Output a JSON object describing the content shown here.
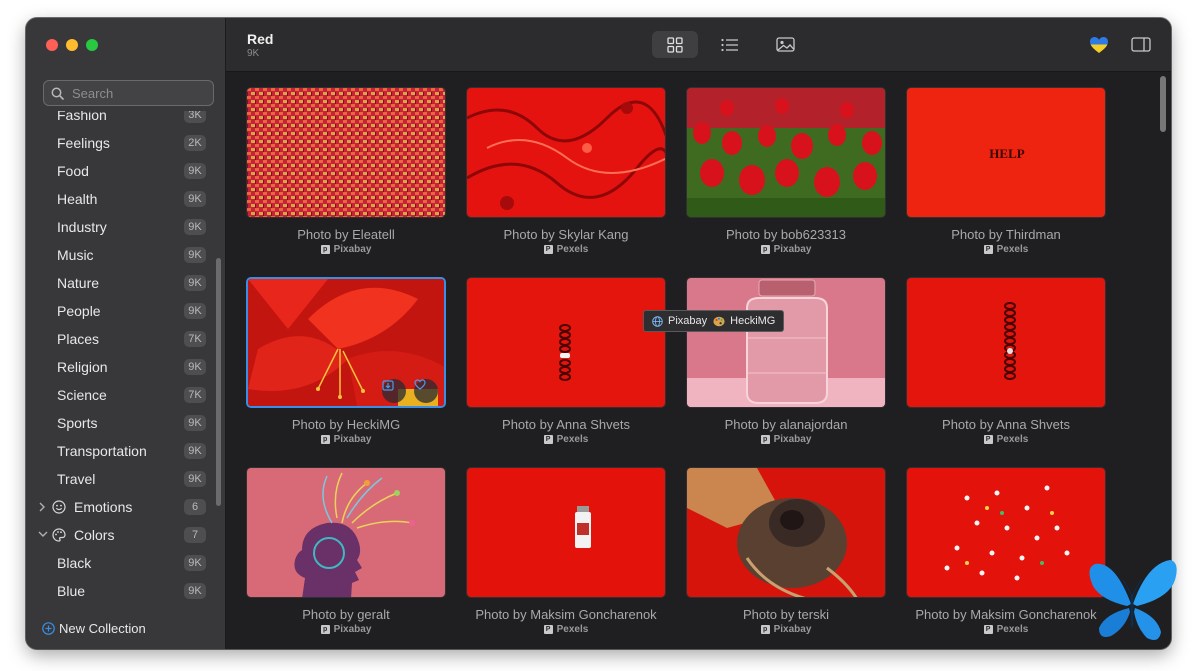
{
  "sidebar": {
    "search_placeholder": "Search",
    "categories": [
      {
        "label": "Fashion",
        "count": "3K"
      },
      {
        "label": "Feelings",
        "count": "2K"
      },
      {
        "label": "Food",
        "count": "9K"
      },
      {
        "label": "Health",
        "count": "9K"
      },
      {
        "label": "Industry",
        "count": "9K"
      },
      {
        "label": "Music",
        "count": "9K"
      },
      {
        "label": "Nature",
        "count": "9K"
      },
      {
        "label": "People",
        "count": "9K"
      },
      {
        "label": "Places",
        "count": "7K"
      },
      {
        "label": "Religion",
        "count": "9K"
      },
      {
        "label": "Science",
        "count": "7K"
      },
      {
        "label": "Sports",
        "count": "9K"
      },
      {
        "label": "Transportation",
        "count": "9K"
      },
      {
        "label": "Travel",
        "count": "9K"
      }
    ],
    "groups": {
      "emotions": {
        "label": "Emotions",
        "count": "6",
        "icon": "smiley-icon",
        "expanded": false
      },
      "colors": {
        "label": "Colors",
        "count": "7",
        "icon": "palette-icon",
        "expanded": true
      }
    },
    "color_items": [
      {
        "label": "Black",
        "count": "9K"
      },
      {
        "label": "Blue",
        "count": "9K"
      }
    ],
    "new_collection_label": "New Collection"
  },
  "toolbar": {
    "title": "Red",
    "subtitle": "9K",
    "views": [
      {
        "name": "grid-view",
        "icon": "grid-icon",
        "active": true
      },
      {
        "name": "list-view",
        "icon": "list-icon",
        "active": false
      },
      {
        "name": "photo-view",
        "icon": "photo-icon",
        "active": false
      }
    ]
  },
  "photos": [
    {
      "caption": "Photo by Eleatell",
      "source": "Pixabay",
      "selected": false
    },
    {
      "caption": "Photo by Skylar Kang",
      "source": "Pexels",
      "selected": false
    },
    {
      "caption": "Photo by bob623313",
      "source": "Pixabay",
      "selected": false
    },
    {
      "caption": "Photo by Thirdman",
      "source": "Pexels",
      "selected": false,
      "image_text": "HELP"
    },
    {
      "caption": "Photo by HeckiMG",
      "source": "Pixabay",
      "selected": true
    },
    {
      "caption": "Photo by Anna Shvets",
      "source": "Pexels",
      "selected": false
    },
    {
      "caption": "Photo by alanajordan",
      "source": "Pixabay",
      "selected": false
    },
    {
      "caption": "Photo by Anna Shvets",
      "source": "Pexels",
      "selected": false
    },
    {
      "caption": "Photo by geralt",
      "source": "Pixabay",
      "selected": false
    },
    {
      "caption": "Photo by Maksim Goncharenok",
      "source": "Pexels",
      "selected": false
    },
    {
      "caption": "Photo by terski",
      "source": "Pixabay",
      "selected": false
    },
    {
      "caption": "Photo by Maksim Goncharenok",
      "source": "Pexels",
      "selected": false
    }
  ],
  "tooltip": {
    "source": "Pixabay",
    "author": "HeckiMG"
  },
  "colors": {
    "accent": "#3a8ee6",
    "sidebar_bg": "#38383a",
    "main_bg": "#1f1f21"
  }
}
